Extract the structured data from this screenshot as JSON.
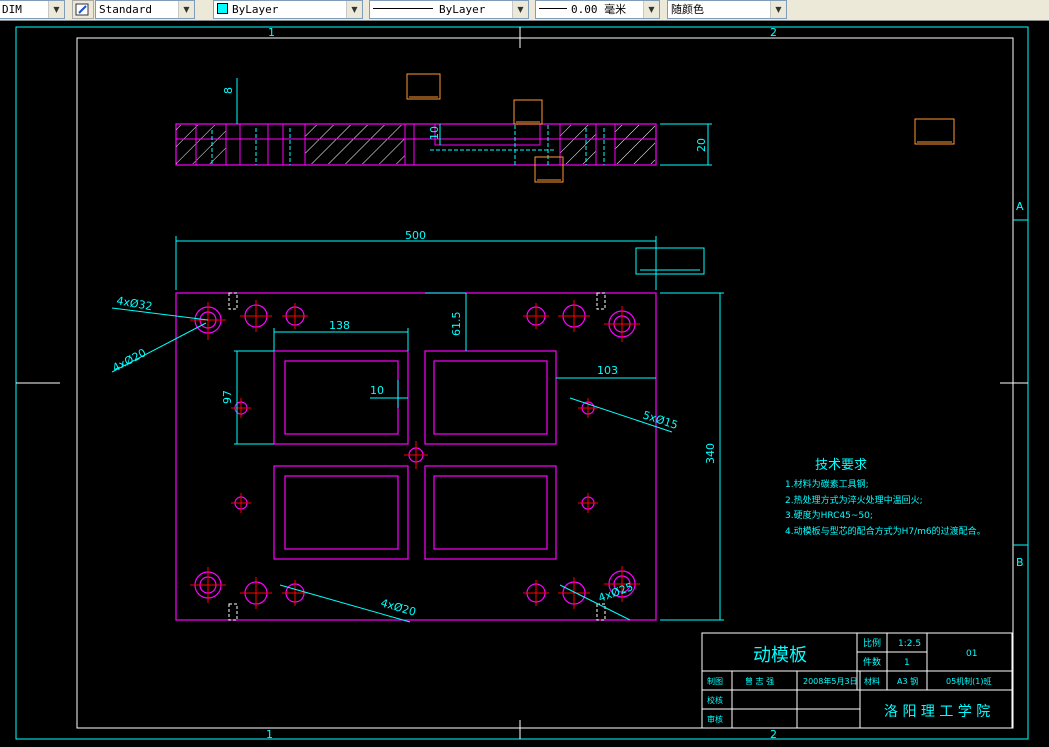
{
  "toolbar": {
    "dim_style": "DIM",
    "text_style": "Standard",
    "layer": "ByLayer",
    "linetype": "ByLayer",
    "lineweight": "0.00 毫米",
    "color": "随颜色"
  },
  "border": {
    "zone_top_1": "1",
    "zone_top_2": "2",
    "zone_bottom_1": "1",
    "zone_bottom_2": "2",
    "zone_right_a": "A",
    "zone_right_b": "B"
  },
  "dimensions": {
    "d8": "8",
    "d10": "10",
    "d20": "20",
    "d500": "500",
    "d61_5": "61.5",
    "d138": "138",
    "d103": "103",
    "d10b": "10",
    "d97": "97",
    "d340": "340",
    "hole_4x32": "4xØ32",
    "hole_4x20_top": "4xØ20",
    "hole_5x15": "5xØ15",
    "hole_4x20_bottom": "4xØ20",
    "hole_4x25": "4xØ25"
  },
  "tech": {
    "title": "技术要求",
    "items": [
      "1.材料为碳素工具钢;",
      "2.热处理方式为淬火处理中温回火;",
      "3.硬度为HRC45~50;",
      "4.动模板与型芯的配合方式为H7/m6的过渡配合。"
    ]
  },
  "title_block": {
    "part_name": "动模板",
    "scale_label": "比例",
    "scale_value": "1:2.5",
    "qty_label": "件数",
    "qty_value": "1",
    "code": "01",
    "draw_label": "制图",
    "drawer": "曾 志 强",
    "date": "2008年5月3日",
    "material_label": "材料",
    "material": "A3 钢",
    "class": "05机制(1)班",
    "check_label": "校核",
    "review_label": "审核",
    "school": "洛 阳 理 工 学 院"
  },
  "colors": {
    "cyan": "#00ffff",
    "magenta": "#ff00ff",
    "red": "#ff0000",
    "white": "#ffffff",
    "orange": "#ff9933",
    "green": "#00ff00",
    "blue": "#4466ff"
  }
}
